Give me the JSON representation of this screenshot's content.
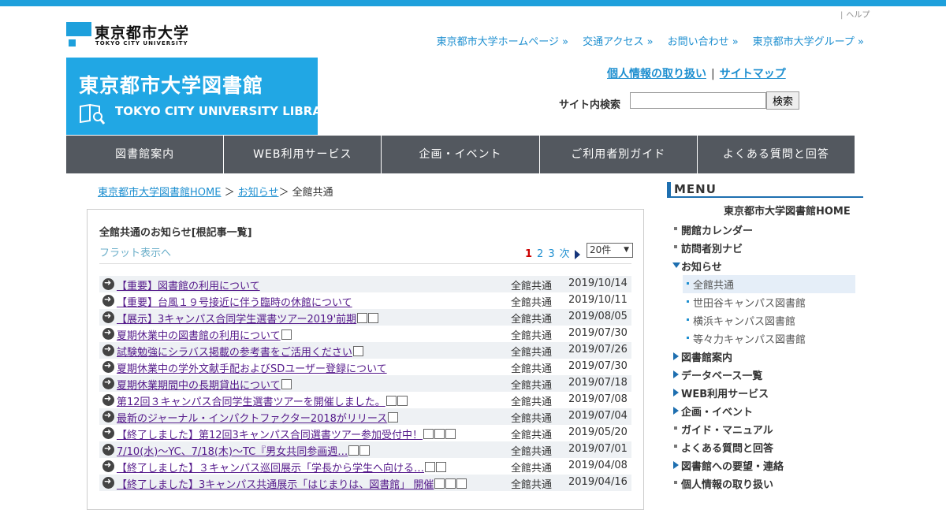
{
  "header": {
    "help_label": "ヘルプ",
    "logo_jp": "東京都市大学",
    "logo_en": "TOKYO CITY UNIVERSITY",
    "top_links": [
      "東京都市大学ホームページ",
      "交通アクセス",
      "お問い合わせ",
      "東京都市大学グループ"
    ],
    "banner_jp": "東京都市大学図書館",
    "banner_en": "TOKYO CITY UNIVERSITY LIBRARY",
    "privacy_label": "個人情報の取り扱い",
    "sitemap_label": "サイトマップ",
    "search_label": "サイト内検索",
    "search_value": "",
    "search_button": "検索"
  },
  "nav": [
    "図書館案内",
    "WEB利用サービス",
    "企画・イベント",
    "ご利用者別ガイド",
    "よくある質問と回答"
  ],
  "breadcrumb": {
    "home": "東京都市大学図書館HOME",
    "news": "お知らせ",
    "current": "全館共通"
  },
  "main": {
    "title": "全館共通のお知らせ[根記事一覧]",
    "flat_link": "フラット表示へ",
    "pages": [
      "1",
      "2",
      "3"
    ],
    "next_label": "次",
    "per_page": "20件",
    "items": [
      {
        "title": "【重要】図書館の利用について",
        "icons": 0,
        "category": "全館共通",
        "date": "2019/10/14"
      },
      {
        "title": "【重要】台風１９号接近に伴う臨時の休館について",
        "icons": 0,
        "category": "全館共通",
        "date": "2019/10/11"
      },
      {
        "title": "【展示】3キャンパス合同学生選書ツアー2019'前期",
        "icons": 2,
        "category": "全館共通",
        "date": "2019/08/05"
      },
      {
        "title": "夏期休業中の図書館の利用について",
        "icons": 1,
        "category": "全館共通",
        "date": "2019/07/30"
      },
      {
        "title": "試験勉強にシラバス掲載の参考書をご活用ください",
        "icons": 1,
        "category": "全館共通",
        "date": "2019/07/26"
      },
      {
        "title": "夏期休業中の学外文献手配およびSDユーザー登録について",
        "icons": 0,
        "category": "全館共通",
        "date": "2019/07/30"
      },
      {
        "title": "夏期休業期間中の長期貸出について",
        "icons": 1,
        "category": "全館共通",
        "date": "2019/07/18"
      },
      {
        "title": "第12回３キャンパス合同学生選書ツアーを開催しました。",
        "icons": 2,
        "category": "全館共通",
        "date": "2019/07/08"
      },
      {
        "title": "最新のジャーナル・インパクトファクター2018がリリース",
        "icons": 1,
        "category": "全館共通",
        "date": "2019/07/04"
      },
      {
        "title": "【終了しました】第12回3キャンパス合同選書ツアー参加受付中！",
        "icons": 3,
        "category": "全館共通",
        "date": "2019/05/20"
      },
      {
        "title": "7/10(水)～YC、7/18(木)～TC『男女共同参画週…",
        "icons": 2,
        "category": "全館共通",
        "date": "2019/07/01"
      },
      {
        "title": "【終了しました】３キャンパス巡回展示「学長から学生へ向ける…",
        "icons": 2,
        "category": "全館共通",
        "date": "2019/04/08"
      },
      {
        "title": "【終了しました】3キャンパス共通展示「はじまりは、図書館」 開催",
        "icons": 3,
        "category": "全館共通",
        "date": "2019/04/16"
      }
    ]
  },
  "menu": {
    "heading": "MENU",
    "home": "東京都市大学図書館HOME",
    "items": [
      {
        "label": "開館カレンダー",
        "type": "dot"
      },
      {
        "label": "訪問者別ナビ",
        "type": "dot"
      },
      {
        "label": "お知らせ",
        "type": "open"
      },
      {
        "label": "全館共通",
        "type": "sub-active"
      },
      {
        "label": "世田谷キャンパス図書館",
        "type": "sub"
      },
      {
        "label": "横浜キャンパス図書館",
        "type": "sub"
      },
      {
        "label": "等々力キャンパス図書館",
        "type": "sub"
      },
      {
        "label": "図書館案内",
        "type": "tri"
      },
      {
        "label": "データベース一覧",
        "type": "tri"
      },
      {
        "label": "WEB利用サービス",
        "type": "tri"
      },
      {
        "label": "企画・イベント",
        "type": "tri"
      },
      {
        "label": "ガイド・マニュアル",
        "type": "dot"
      },
      {
        "label": "よくある質問と回答",
        "type": "dot"
      },
      {
        "label": "図書館への要望・連絡",
        "type": "tri"
      },
      {
        "label": "個人情報の取り扱い",
        "type": "dot"
      }
    ]
  },
  "colors": {
    "brand": "#1ea0dc",
    "nav_bg": "#53585f",
    "link": "#1e8fd0",
    "visited": "#551a8b"
  }
}
